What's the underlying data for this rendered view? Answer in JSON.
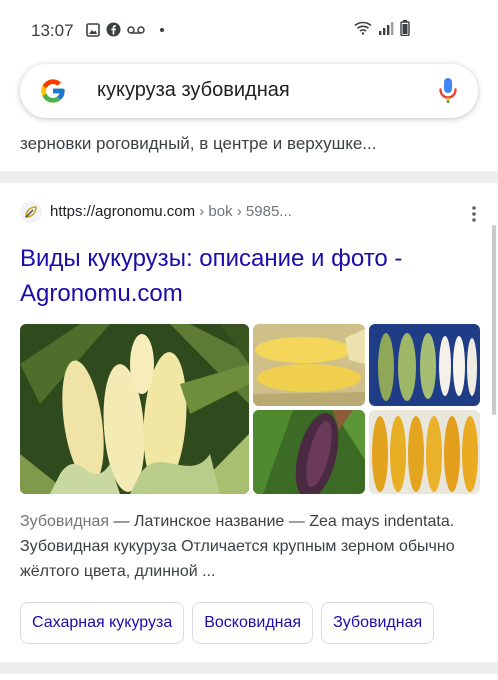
{
  "status_bar": {
    "time": "13:07",
    "left_icons": [
      "image-icon",
      "facebook-icon",
      "voicemail-icon",
      "dot-icon"
    ],
    "right_icons": [
      "wifi-icon",
      "signal-icon",
      "battery-icon"
    ]
  },
  "search": {
    "query": "кукуруза зубовидная",
    "icons": [
      "google-logo-icon",
      "microphone-icon"
    ]
  },
  "previous_result": {
    "snippet_tail": "зерновки роговидный, в центре и верхушке..."
  },
  "result": {
    "url": "https://agronomu.com",
    "path": " › bok › 5985...",
    "title": "Виды кукурузы: описание и фото - Agronomu.com",
    "snippet_source": "Зубовидная",
    "snippet_text": " — Латинское название — Zea mays indentata. Зубовидная кукуруза Отличается крупным зерном обычно жёлтого цвета, длинной ...",
    "chips": [
      "Сахарная кукуруза",
      "Восковидная",
      "Зубовидная"
    ]
  },
  "colors": {
    "link": "#1a0dab",
    "text": "#202124",
    "muted": "#70757a",
    "separator": "#eeeeef"
  }
}
